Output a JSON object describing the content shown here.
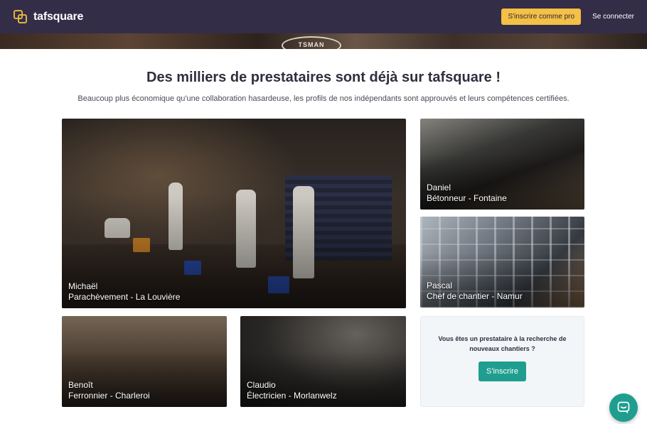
{
  "header": {
    "brand": "tafsquare",
    "pro_button": "S'inscrire comme pro",
    "login": "Se connecter"
  },
  "hero": {
    "stamp_text": "TSMAN"
  },
  "main": {
    "title": "Des milliers de prestataires sont déjà sur tafsquare !",
    "subtitle": "Beaucoup plus économique qu'une collaboration hasardeuse, les profils de nos indépendants sont approuvés et leurs compétences certifiées."
  },
  "providers": [
    {
      "name": "Michaël",
      "role": "Parachèvement - La Louvière"
    },
    {
      "name": "Daniel",
      "role": "Bétonneur - Fontaine"
    },
    {
      "name": "Pascal",
      "role": "Chef de chantier - Namur"
    },
    {
      "name": "Benoît",
      "role": "Ferronnier - Charleroi"
    },
    {
      "name": "Claudio",
      "role": "Électricien - Morlanwelz"
    }
  ],
  "cta": {
    "text": "Vous êtes un prestataire à la recherche de nouveaux chantiers ?",
    "button": "S'inscrire"
  },
  "colors": {
    "header_bg": "#332d48",
    "accent_yellow": "#f4c045",
    "accent_teal": "#1f9e90"
  },
  "icons": {
    "brand": "tafsquare-logo-icon",
    "chat": "chat-bubble-icon"
  }
}
